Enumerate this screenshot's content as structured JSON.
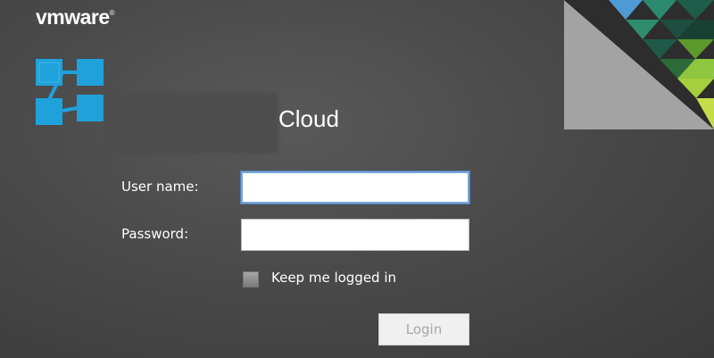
{
  "header": {
    "brand": "vmware",
    "brand_mark": "®"
  },
  "product": {
    "title": "Cloud",
    "icon": "vcloud-logo-icon"
  },
  "login_form": {
    "username_label": "User name:",
    "username_value": "",
    "password_label": "Password:",
    "password_value": "",
    "keep_logged_in_label": "Keep me logged in",
    "keep_logged_in_checked": false,
    "login_button": "Login"
  },
  "colors": {
    "background": "#4a4a4a",
    "logo_blue": "#1fa2dc",
    "focus_border": "#7aa6d6",
    "corner_gray": "#a3a3a3"
  }
}
